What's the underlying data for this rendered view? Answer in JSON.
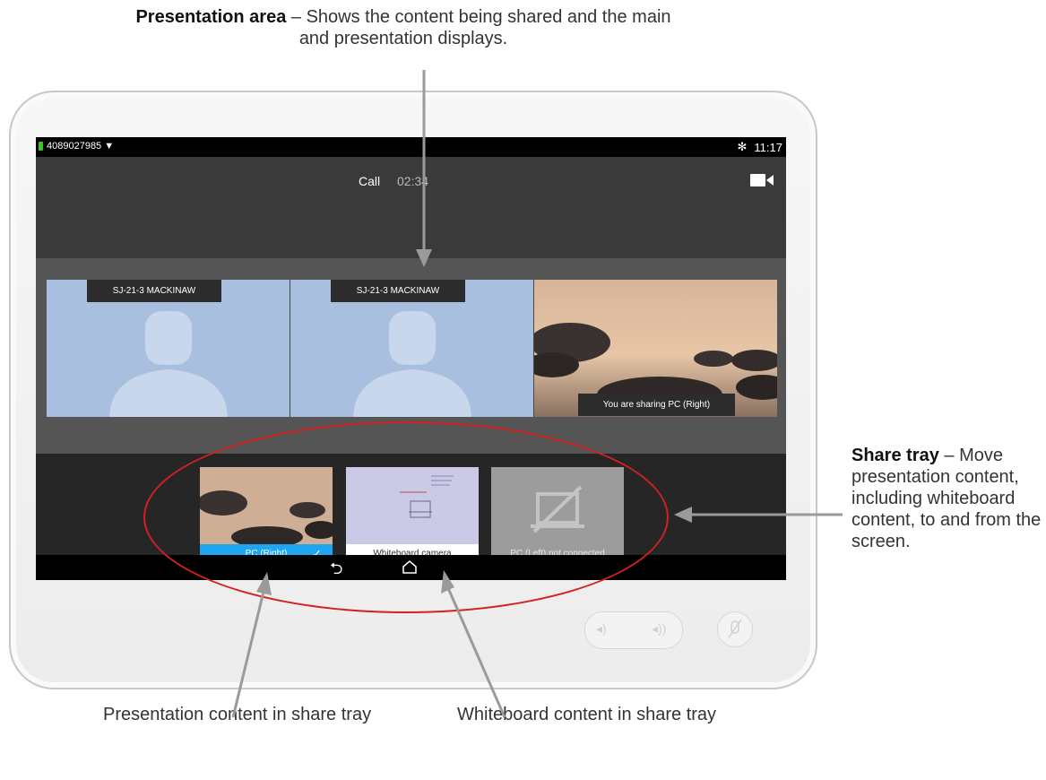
{
  "callouts": {
    "presentation_title": "Presentation area",
    "presentation_desc": " – Shows the content being shared and the main and presentation displays.",
    "share_title": "Share tray",
    "share_desc": " – Move presentation content, including whiteboard content, to and from the screen.",
    "pc_content": "Presentation content in share tray",
    "whiteboard_content": "Whiteboard content in share tray"
  },
  "statusbar": {
    "number": "4089027985 ▼",
    "time": "11:17",
    "bluetooth_icon": "bluetooth-icon"
  },
  "call": {
    "label": "Call",
    "duration": "02:34"
  },
  "tiles": [
    {
      "name": "SJ-21-3 MACKINAW"
    },
    {
      "name": "SJ-21-3 MACKINAW"
    }
  ],
  "sharing_note": "You are sharing PC (Right)",
  "share_tray": [
    {
      "label": "PC (Right)",
      "selected": true,
      "check": "✓"
    },
    {
      "label": "Whiteboard camera",
      "selected": false
    },
    {
      "label": "PC (Left) not connected",
      "selected": false,
      "disabled": true
    }
  ],
  "nav": {
    "back_icon": "back-icon",
    "home_icon": "home-icon"
  },
  "colors": {
    "accent": "#1ea7f0",
    "annotation": "#d42020",
    "status_green": "#39c42c"
  }
}
